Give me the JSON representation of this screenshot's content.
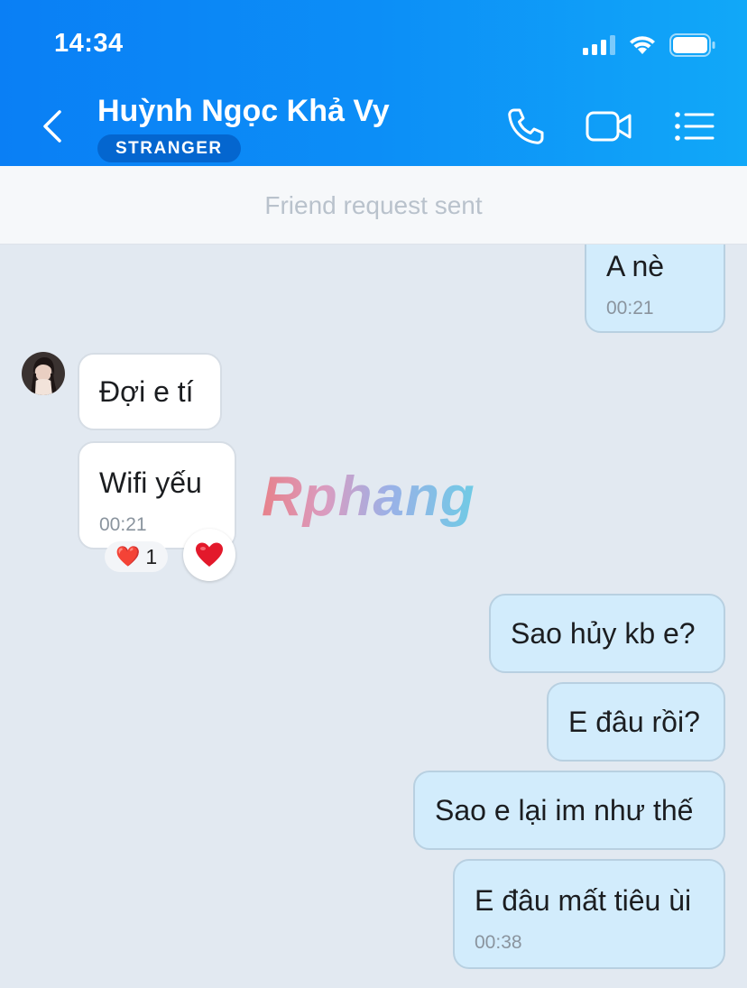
{
  "status_bar": {
    "time": "14:34"
  },
  "header": {
    "contact_name": "Huỳnh Ngọc Khả Vy",
    "badge": "STRANGER",
    "icons": [
      "back-icon",
      "phone-icon",
      "video-call-icon",
      "menu-list-icon"
    ]
  },
  "notice": "Friend request sent",
  "messages": [
    {
      "direction": "out",
      "text": "A nè",
      "time": "00:21"
    },
    {
      "direction": "in",
      "text": "Đợi e tí"
    },
    {
      "direction": "in",
      "text": "Wifi yếu",
      "time": "00:21",
      "reaction": {
        "emoji": "❤️",
        "count": "1"
      }
    },
    {
      "direction": "out",
      "text": "Sao hủy kb e?"
    },
    {
      "direction": "out",
      "text": "E đâu rồi?"
    },
    {
      "direction": "out",
      "text": "Sao e lại im như thế"
    },
    {
      "direction": "out",
      "text": "E đâu mất tiêu ùi",
      "time": "00:38"
    }
  ],
  "watermark": "Rphang",
  "colors": {
    "header_start": "#0a7ff5",
    "header_end": "#11a8f8",
    "out_bubble": "#d2ecfc",
    "chat_bg": "#e2e9f1"
  }
}
